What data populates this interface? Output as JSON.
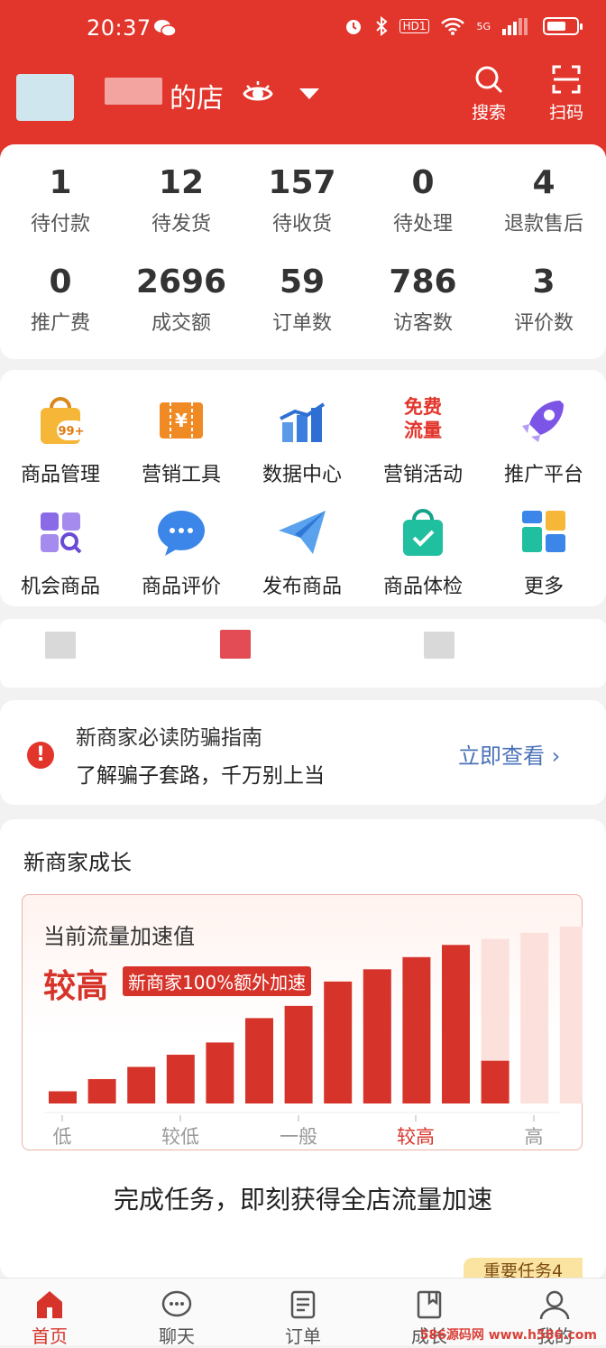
{
  "status_bar": {
    "time": "20:37",
    "network": "5G",
    "hd": "HD1"
  },
  "header": {
    "store_suffix": "的店",
    "actions": [
      {
        "label": "搜索",
        "icon": "search-icon"
      },
      {
        "label": "扫码",
        "icon": "scan-icon"
      }
    ]
  },
  "stats": [
    {
      "value": "1",
      "label": "待付款"
    },
    {
      "value": "12",
      "label": "待发货"
    },
    {
      "value": "157",
      "label": "待收货"
    },
    {
      "value": "0",
      "label": "待处理"
    },
    {
      "value": "4",
      "label": "退款售后"
    },
    {
      "value": "0",
      "label": "推广费"
    },
    {
      "value": "2696",
      "label": "成交额"
    },
    {
      "value": "59",
      "label": "订单数"
    },
    {
      "value": "786",
      "label": "访客数"
    },
    {
      "value": "3",
      "label": "评价数"
    }
  ],
  "tools": [
    {
      "label": "商品管理",
      "icon": "shopping-bag-icon",
      "badge": "99+"
    },
    {
      "label": "营销工具",
      "icon": "coupon-icon",
      "badge": "¥"
    },
    {
      "label": "数据中心",
      "icon": "bar-chart-icon"
    },
    {
      "label": "营销活动",
      "icon": "free-traffic-icon",
      "text": [
        "免费",
        "流量"
      ]
    },
    {
      "label": "推广平台",
      "icon": "rocket-icon"
    },
    {
      "label": "机会商品",
      "icon": "grid-search-icon"
    },
    {
      "label": "商品评价",
      "icon": "chat-bubble-icon"
    },
    {
      "label": "发布商品",
      "icon": "paper-plane-icon"
    },
    {
      "label": "商品体检",
      "icon": "checked-bag-icon"
    },
    {
      "label": "更多",
      "icon": "more-apps-icon"
    }
  ],
  "alert": {
    "title": "新商家必读防骗指南",
    "subtitle": "了解骗子套路，千万别上当",
    "link": "立即查看 ›"
  },
  "growth": {
    "title": "新商家成长",
    "accel_label": "当前流量加速值",
    "accel_level": "较高",
    "badge": "新商家100%额外加速",
    "task_text": "完成任务，即刻获得全店流量加速",
    "tag": "重要任务4"
  },
  "chart_data": {
    "type": "bar",
    "title": "",
    "xlabel": "",
    "ylabel": "",
    "tick_labels": [
      "低",
      "较低",
      "一般",
      "较高",
      "高"
    ],
    "current_level": "较高",
    "active_values": [
      1,
      2,
      3,
      4,
      5,
      7,
      8,
      10,
      11,
      12,
      13
    ],
    "inactive_values": [
      13.5,
      14,
      14.5
    ],
    "partial_fill_value": 3.5,
    "colors": {
      "active": "#d6342a",
      "inactive": "#fbe0dc"
    }
  },
  "bottom_nav": [
    {
      "label": "首页",
      "icon": "home-icon",
      "active": true
    },
    {
      "label": "聊天",
      "icon": "chat-icon",
      "active": false
    },
    {
      "label": "订单",
      "icon": "order-icon",
      "active": false
    },
    {
      "label": "成长",
      "icon": "growth-icon",
      "active": false
    },
    {
      "label": "我的",
      "icon": "profile-icon",
      "active": false
    }
  ],
  "watermark": "586源码网 www.h586.com",
  "colors": {
    "brand_red": "#e2352b",
    "link_blue": "#4a72b8"
  }
}
